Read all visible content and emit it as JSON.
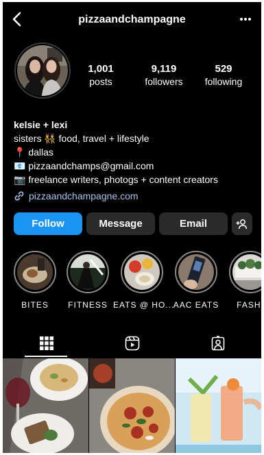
{
  "header": {
    "username": "pizzaandchampagne"
  },
  "stats": {
    "posts": {
      "count": "1,001",
      "label": "posts"
    },
    "followers": {
      "count": "9,119",
      "label": "followers"
    },
    "following": {
      "count": "529",
      "label": "following"
    }
  },
  "bio": {
    "name": "kelsie + lexi",
    "lines": [
      {
        "emoji": "👯",
        "before": "sisters ",
        "after": " food, travel + lifestyle"
      },
      {
        "emoji": "📍",
        "text": " dallas"
      },
      {
        "emoji": "📧",
        "text": " pizzaandchamps@gmail.com"
      },
      {
        "emoji": "📷",
        "text": " freelance writers, photogs + content creators"
      }
    ],
    "link": "pizzaandchampagne.com"
  },
  "buttons": {
    "follow": "Follow",
    "message": "Message",
    "email": "Email"
  },
  "highlights": [
    {
      "label": "BITES"
    },
    {
      "label": "FITNESS"
    },
    {
      "label": "EATS @ HO..."
    },
    {
      "label": "AAC EATS"
    },
    {
      "label": "FASHI"
    }
  ],
  "icons": {
    "back": "back-chevron-icon",
    "more": "more-dots-icon",
    "add_person": "add-person-icon",
    "link": "link-icon",
    "grid": "grid-icon",
    "reels": "reels-icon",
    "tagged": "tagged-icon"
  },
  "colors": {
    "background": "#000000",
    "follow_button": "#1a95f3",
    "secondary_button": "#2b2b2b",
    "link_text": "#a9c6f2"
  }
}
